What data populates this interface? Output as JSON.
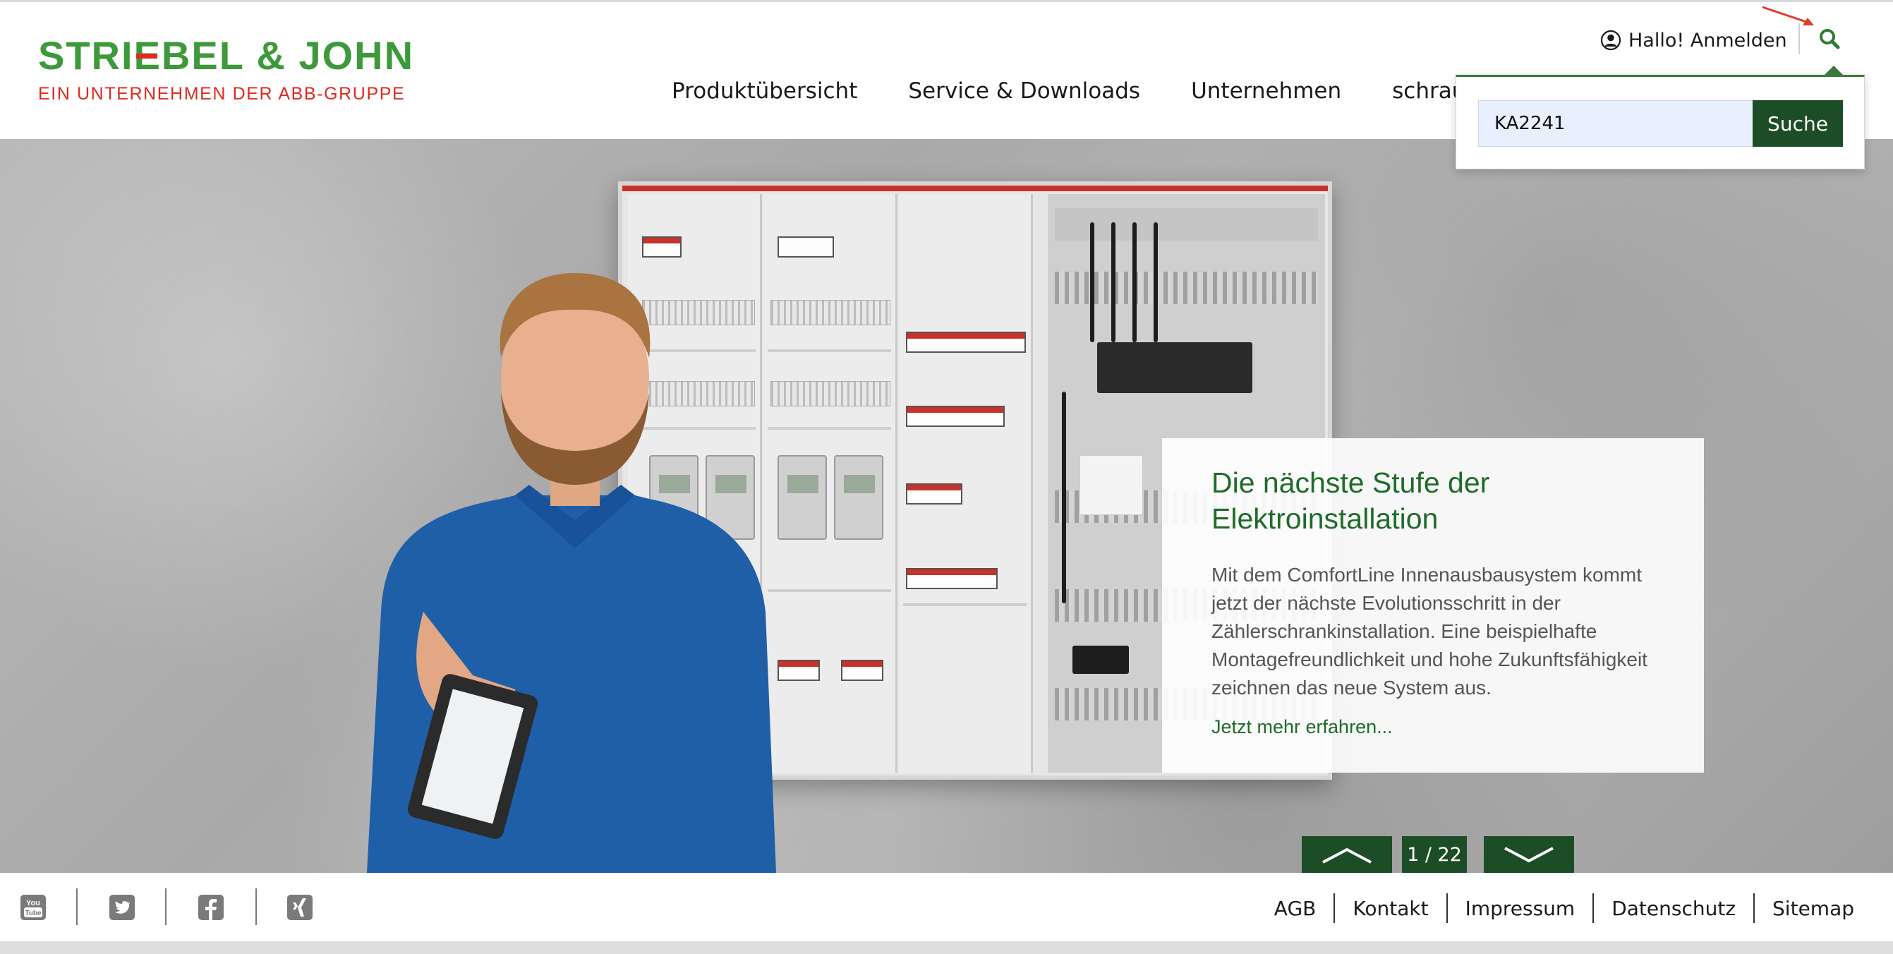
{
  "brand": {
    "name": "STRIEBEL & JOHN",
    "tagline": "EIN UNTERNEHMEN DER ABB-GRUPPE",
    "green": "#3d9a3b",
    "red": "#e0291f"
  },
  "header": {
    "login_label": "Hallo! Anmelden",
    "nav": [
      {
        "label": "Produktübersicht"
      },
      {
        "label": "Service & Downloads"
      },
      {
        "label": "Unternehmen"
      },
      {
        "label": "schraubb"
      }
    ]
  },
  "search": {
    "value": "KA2241",
    "button_label": "Suche",
    "accent": "#1d4d26"
  },
  "hero": {
    "title": "Die nächste Stufe der Elektroinstallation",
    "text": "Mit dem ComfortLine Innenausbausystem kommt jetzt der nächste Evolutionsschritt in der Zählerschrankinstallation. Eine beispielhafte Montagefreundlichkeit und hohe Zukunftsfähigkeit zeichnen das neue System aus.",
    "link_label": "Jetzt mehr erfahren...",
    "slide_counter": "1 / 22"
  },
  "footer": {
    "social": [
      "youtube-icon",
      "twitter-icon",
      "facebook-icon",
      "xing-icon"
    ],
    "links": [
      "AGB",
      "Kontakt",
      "Impressum",
      "Datenschutz",
      "Sitemap"
    ]
  }
}
